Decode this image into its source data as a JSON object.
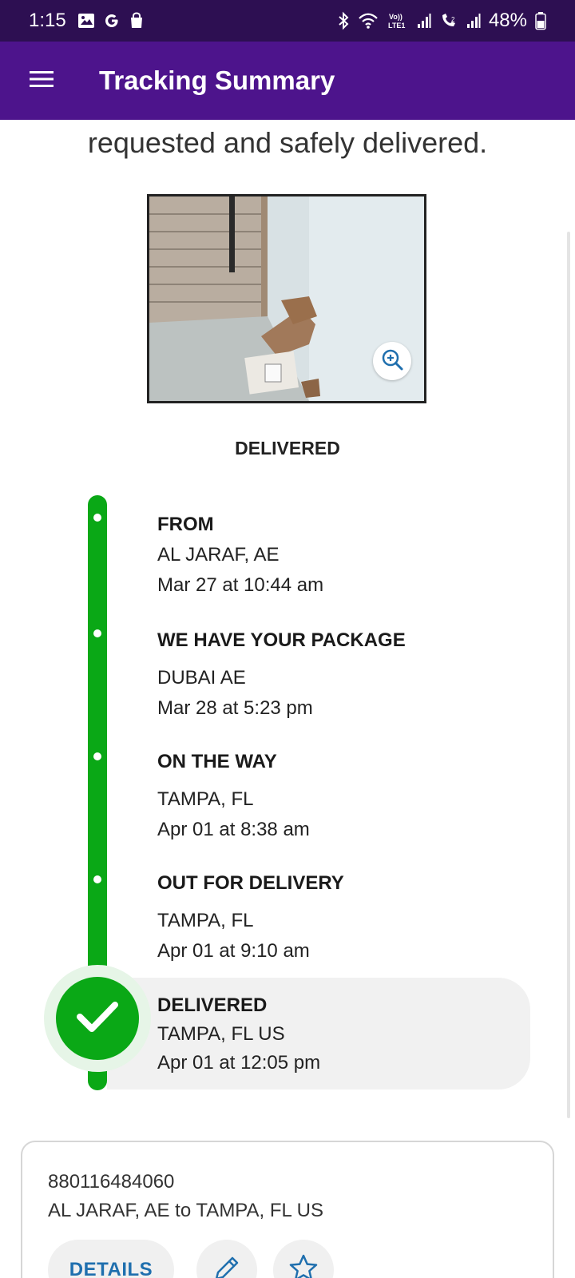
{
  "status_bar": {
    "time": "1:15",
    "battery_percent": "48%",
    "network_label": "VoLTE1"
  },
  "app_bar": {
    "title": "Tracking Summary"
  },
  "intro": {
    "text": "requested and safely delivered."
  },
  "delivery_status": "DELIVERED",
  "timeline": [
    {
      "title": "FROM",
      "location": "AL JARAF, AE",
      "time": "Mar 27 at 10:44 am"
    },
    {
      "title": "WE HAVE YOUR PACKAGE",
      "location": "DUBAI AE",
      "time": "Mar 28 at 5:23 pm"
    },
    {
      "title": "ON THE WAY",
      "location": "TAMPA, FL",
      "time": "Apr 01 at 8:38 am"
    },
    {
      "title": "OUT FOR DELIVERY",
      "location": "TAMPA, FL",
      "time": "Apr 01 at 9:10 am"
    },
    {
      "title": "DELIVERED",
      "location": "TAMPA, FL US",
      "time": "Apr 01 at 12:05 pm"
    }
  ],
  "card": {
    "tracking_number": "880116484060",
    "route": "AL JARAF, AE to TAMPA, FL US",
    "details_label": "DETAILS"
  },
  "colors": {
    "status_bar": "#2d0f52",
    "app_bar": "#4d148c",
    "track_green": "#0aa816",
    "details_blue": "#1f6fae"
  },
  "icons": {
    "menu": "hamburger-menu-icon",
    "zoom": "zoom-in-icon",
    "done": "checkmark-icon",
    "edit": "pencil-icon",
    "favorite": "star-icon"
  }
}
